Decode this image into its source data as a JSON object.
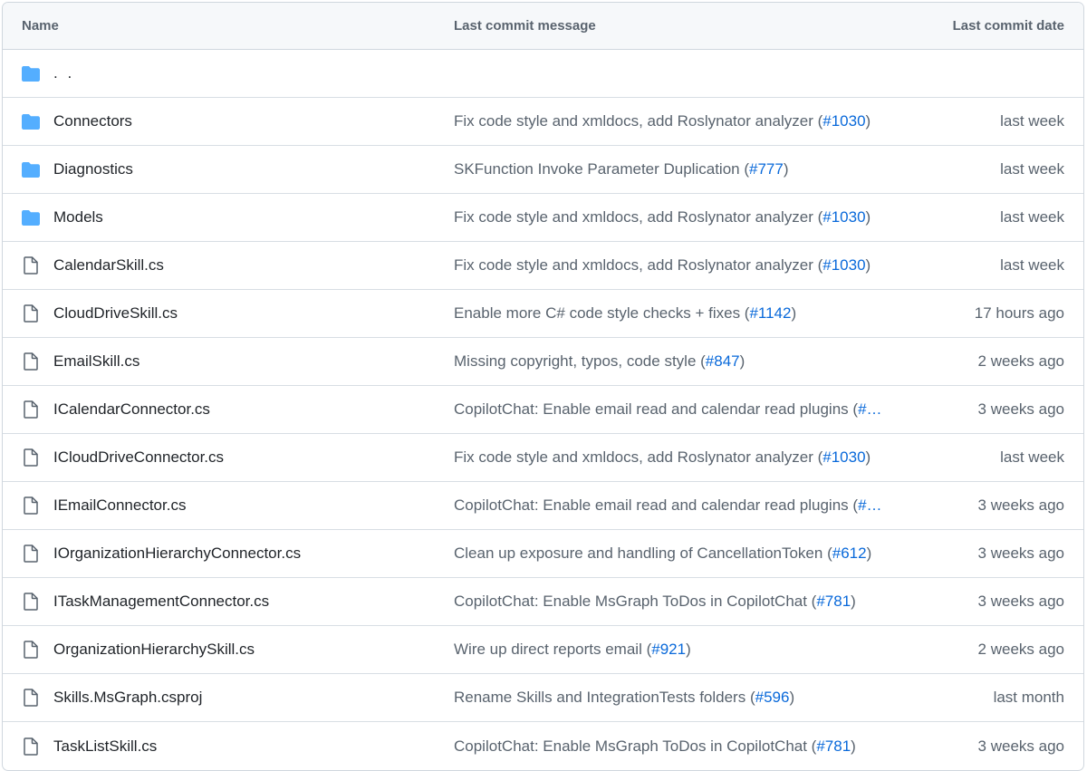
{
  "header": {
    "name": "Name",
    "message": "Last commit message",
    "date": "Last commit date"
  },
  "parent": {
    "label": ". .",
    "icon": "folder-icon"
  },
  "rows": [
    {
      "type": "folder",
      "icon": "folder-icon",
      "name": "Connectors",
      "msg_pre": "Fix code style and xmldocs, add Roslynator analyzer (",
      "pr": "#1030",
      "msg_post": ")",
      "date": "last week"
    },
    {
      "type": "folder",
      "icon": "folder-icon",
      "name": "Diagnostics",
      "msg_pre": "SKFunction Invoke Parameter Duplication (",
      "pr": "#777",
      "msg_post": ")",
      "date": "last week"
    },
    {
      "type": "folder",
      "icon": "folder-icon",
      "name": "Models",
      "msg_pre": "Fix code style and xmldocs, add Roslynator analyzer (",
      "pr": "#1030",
      "msg_post": ")",
      "date": "last week"
    },
    {
      "type": "file",
      "icon": "file-icon",
      "name": "CalendarSkill.cs",
      "msg_pre": "Fix code style and xmldocs, add Roslynator analyzer (",
      "pr": "#1030",
      "msg_post": ")",
      "date": "last week"
    },
    {
      "type": "file",
      "icon": "file-icon",
      "name": "CloudDriveSkill.cs",
      "msg_pre": "Enable more C# code style checks + fixes (",
      "pr": "#1142",
      "msg_post": ")",
      "date": "17 hours ago"
    },
    {
      "type": "file",
      "icon": "file-icon",
      "name": "EmailSkill.cs",
      "msg_pre": "Missing copyright, typos, code style (",
      "pr": "#847",
      "msg_post": ")",
      "date": "2 weeks ago"
    },
    {
      "type": "file",
      "icon": "file-icon",
      "name": "ICalendarConnector.cs",
      "msg_pre": "CopilotChat: Enable email read and calendar read plugins (",
      "pr": "#…",
      "msg_post": "",
      "date": "3 weeks ago"
    },
    {
      "type": "file",
      "icon": "file-icon",
      "name": "ICloudDriveConnector.cs",
      "msg_pre": "Fix code style and xmldocs, add Roslynator analyzer (",
      "pr": "#1030",
      "msg_post": ")",
      "date": "last week"
    },
    {
      "type": "file",
      "icon": "file-icon",
      "name": "IEmailConnector.cs",
      "msg_pre": "CopilotChat: Enable email read and calendar read plugins (",
      "pr": "#…",
      "msg_post": "",
      "date": "3 weeks ago"
    },
    {
      "type": "file",
      "icon": "file-icon",
      "name": "IOrganizationHierarchyConnector.cs",
      "msg_pre": "Clean up exposure and handling of CancellationToken (",
      "pr": "#612",
      "msg_post": ")",
      "date": "3 weeks ago"
    },
    {
      "type": "file",
      "icon": "file-icon",
      "name": "ITaskManagementConnector.cs",
      "msg_pre": "CopilotChat: Enable MsGraph ToDos in CopilotChat (",
      "pr": "#781",
      "msg_post": ")",
      "date": "3 weeks ago"
    },
    {
      "type": "file",
      "icon": "file-icon",
      "name": "OrganizationHierarchySkill.cs",
      "msg_pre": "Wire up direct reports email (",
      "pr": "#921",
      "msg_post": ")",
      "date": "2 weeks ago"
    },
    {
      "type": "file",
      "icon": "file-icon",
      "name": "Skills.MsGraph.csproj",
      "msg_pre": "Rename Skills and IntegrationTests folders (",
      "pr": "#596",
      "msg_post": ")",
      "date": "last month"
    },
    {
      "type": "file",
      "icon": "file-icon",
      "name": "TaskListSkill.cs",
      "msg_pre": "CopilotChat: Enable MsGraph ToDos in CopilotChat (",
      "pr": "#781",
      "msg_post": ")",
      "date": "3 weeks ago"
    }
  ],
  "colors": {
    "folder": "#54aeff",
    "file_icon": "#59636e",
    "link": "#0969da",
    "header_bg": "#f6f8fa",
    "border": "#d0d7de"
  }
}
